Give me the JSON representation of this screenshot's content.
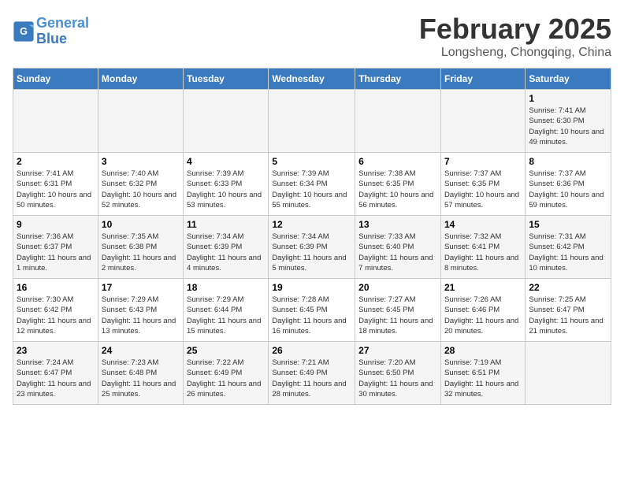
{
  "logo": {
    "line1": "General",
    "line2": "Blue"
  },
  "title": "February 2025",
  "location": "Longsheng, Chongqing, China",
  "days_of_week": [
    "Sunday",
    "Monday",
    "Tuesday",
    "Wednesday",
    "Thursday",
    "Friday",
    "Saturday"
  ],
  "weeks": [
    [
      {
        "day": "",
        "info": ""
      },
      {
        "day": "",
        "info": ""
      },
      {
        "day": "",
        "info": ""
      },
      {
        "day": "",
        "info": ""
      },
      {
        "day": "",
        "info": ""
      },
      {
        "day": "",
        "info": ""
      },
      {
        "day": "1",
        "info": "Sunrise: 7:41 AM\nSunset: 6:30 PM\nDaylight: 10 hours and 49 minutes."
      }
    ],
    [
      {
        "day": "2",
        "info": "Sunrise: 7:41 AM\nSunset: 6:31 PM\nDaylight: 10 hours and 50 minutes."
      },
      {
        "day": "3",
        "info": "Sunrise: 7:40 AM\nSunset: 6:32 PM\nDaylight: 10 hours and 52 minutes."
      },
      {
        "day": "4",
        "info": "Sunrise: 7:39 AM\nSunset: 6:33 PM\nDaylight: 10 hours and 53 minutes."
      },
      {
        "day": "5",
        "info": "Sunrise: 7:39 AM\nSunset: 6:34 PM\nDaylight: 10 hours and 55 minutes."
      },
      {
        "day": "6",
        "info": "Sunrise: 7:38 AM\nSunset: 6:35 PM\nDaylight: 10 hours and 56 minutes."
      },
      {
        "day": "7",
        "info": "Sunrise: 7:37 AM\nSunset: 6:35 PM\nDaylight: 10 hours and 57 minutes."
      },
      {
        "day": "8",
        "info": "Sunrise: 7:37 AM\nSunset: 6:36 PM\nDaylight: 10 hours and 59 minutes."
      }
    ],
    [
      {
        "day": "9",
        "info": "Sunrise: 7:36 AM\nSunset: 6:37 PM\nDaylight: 11 hours and 1 minute."
      },
      {
        "day": "10",
        "info": "Sunrise: 7:35 AM\nSunset: 6:38 PM\nDaylight: 11 hours and 2 minutes."
      },
      {
        "day": "11",
        "info": "Sunrise: 7:34 AM\nSunset: 6:39 PM\nDaylight: 11 hours and 4 minutes."
      },
      {
        "day": "12",
        "info": "Sunrise: 7:34 AM\nSunset: 6:39 PM\nDaylight: 11 hours and 5 minutes."
      },
      {
        "day": "13",
        "info": "Sunrise: 7:33 AM\nSunset: 6:40 PM\nDaylight: 11 hours and 7 minutes."
      },
      {
        "day": "14",
        "info": "Sunrise: 7:32 AM\nSunset: 6:41 PM\nDaylight: 11 hours and 8 minutes."
      },
      {
        "day": "15",
        "info": "Sunrise: 7:31 AM\nSunset: 6:42 PM\nDaylight: 11 hours and 10 minutes."
      }
    ],
    [
      {
        "day": "16",
        "info": "Sunrise: 7:30 AM\nSunset: 6:42 PM\nDaylight: 11 hours and 12 minutes."
      },
      {
        "day": "17",
        "info": "Sunrise: 7:29 AM\nSunset: 6:43 PM\nDaylight: 11 hours and 13 minutes."
      },
      {
        "day": "18",
        "info": "Sunrise: 7:29 AM\nSunset: 6:44 PM\nDaylight: 11 hours and 15 minutes."
      },
      {
        "day": "19",
        "info": "Sunrise: 7:28 AM\nSunset: 6:45 PM\nDaylight: 11 hours and 16 minutes."
      },
      {
        "day": "20",
        "info": "Sunrise: 7:27 AM\nSunset: 6:45 PM\nDaylight: 11 hours and 18 minutes."
      },
      {
        "day": "21",
        "info": "Sunrise: 7:26 AM\nSunset: 6:46 PM\nDaylight: 11 hours and 20 minutes."
      },
      {
        "day": "22",
        "info": "Sunrise: 7:25 AM\nSunset: 6:47 PM\nDaylight: 11 hours and 21 minutes."
      }
    ],
    [
      {
        "day": "23",
        "info": "Sunrise: 7:24 AM\nSunset: 6:47 PM\nDaylight: 11 hours and 23 minutes."
      },
      {
        "day": "24",
        "info": "Sunrise: 7:23 AM\nSunset: 6:48 PM\nDaylight: 11 hours and 25 minutes."
      },
      {
        "day": "25",
        "info": "Sunrise: 7:22 AM\nSunset: 6:49 PM\nDaylight: 11 hours and 26 minutes."
      },
      {
        "day": "26",
        "info": "Sunrise: 7:21 AM\nSunset: 6:49 PM\nDaylight: 11 hours and 28 minutes."
      },
      {
        "day": "27",
        "info": "Sunrise: 7:20 AM\nSunset: 6:50 PM\nDaylight: 11 hours and 30 minutes."
      },
      {
        "day": "28",
        "info": "Sunrise: 7:19 AM\nSunset: 6:51 PM\nDaylight: 11 hours and 32 minutes."
      },
      {
        "day": "",
        "info": ""
      }
    ]
  ]
}
